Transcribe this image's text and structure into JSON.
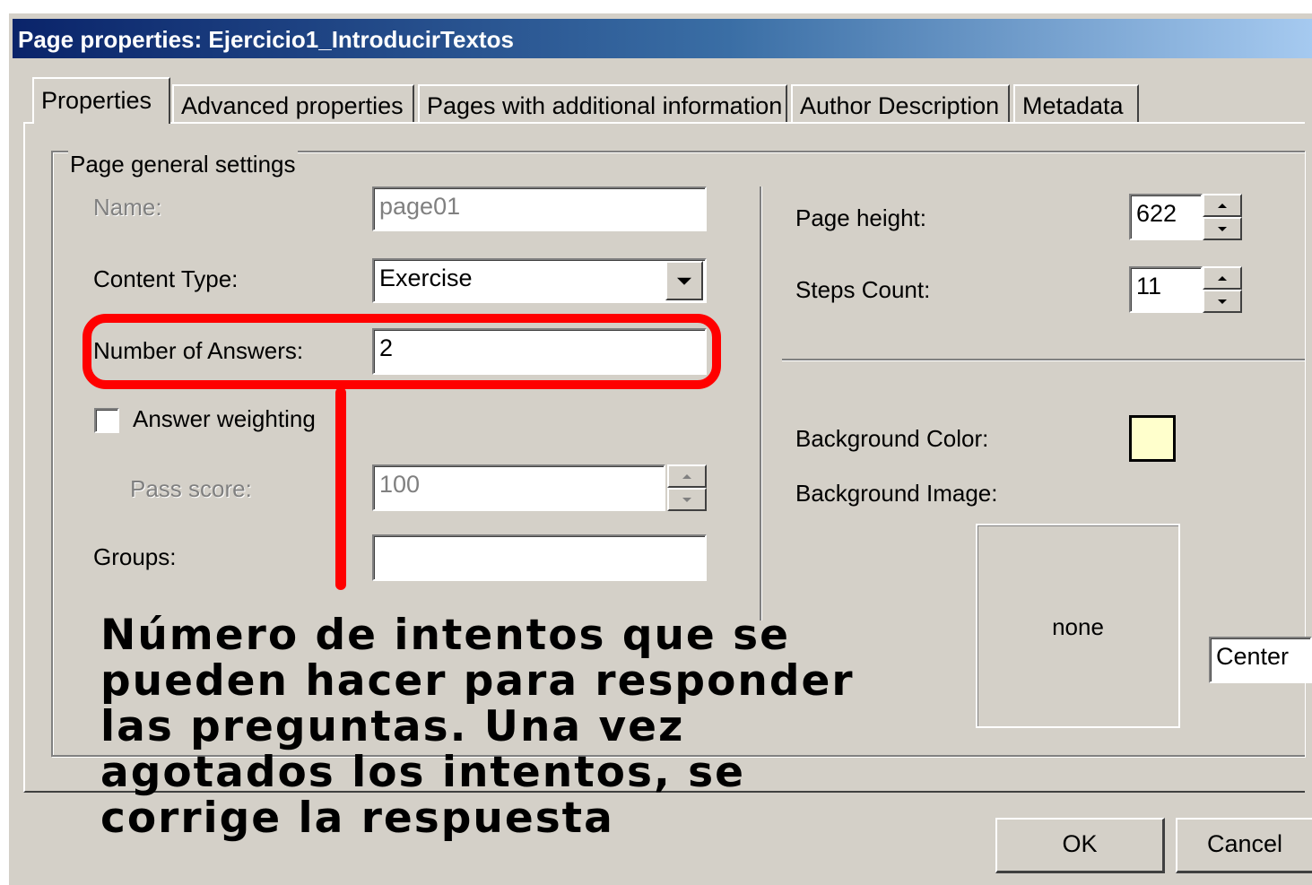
{
  "window": {
    "title": "Page properties: Ejercicio1_IntroducirTextos"
  },
  "tabs": [
    {
      "label": "Properties",
      "active": true
    },
    {
      "label": "Advanced properties",
      "active": false
    },
    {
      "label": "Pages with additional information",
      "active": false
    },
    {
      "label": "Author Description",
      "active": false
    },
    {
      "label": "Metadata",
      "active": false
    }
  ],
  "group": {
    "legend": "Page general settings"
  },
  "form": {
    "name_label": "Name:",
    "name_value": "page01",
    "content_type_label": "Content Type:",
    "content_type_value": "Exercise",
    "answers_label": "Number of Answers:",
    "answers_value": "2",
    "weighting_label": "Answer weighting",
    "weighting_checked": false,
    "pass_score_label": "Pass score:",
    "pass_score_value": "100",
    "groups_label": "Groups:",
    "groups_value": ""
  },
  "right": {
    "page_height_label": "Page height:",
    "page_height_value": "622",
    "steps_count_label": "Steps Count:",
    "steps_count_value": "11",
    "bg_color_label": "Background Color:",
    "bg_color": "#ffffcc",
    "bg_image_label": "Background Image:",
    "bg_image_value": "none",
    "alignment_value": "Center"
  },
  "buttons": {
    "ok": "OK",
    "cancel": "Cancel"
  },
  "annotation": {
    "text": "Número de intentos que se pueden hacer para responder las preguntas. Una vez agotados los intentos, se corrige la respuesta",
    "highlight_color": "#ff0000"
  }
}
